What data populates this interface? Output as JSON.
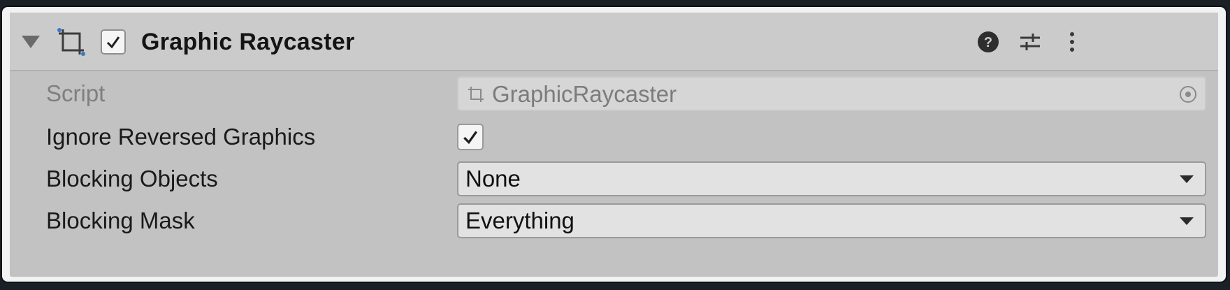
{
  "component": {
    "title": "Graphic Raycaster",
    "enabled": true,
    "header_icons": [
      "help-icon",
      "presets-icon",
      "more-options-icon"
    ]
  },
  "properties": {
    "script": {
      "label": "Script",
      "value": "GraphicRaycaster"
    },
    "ignore_reversed_graphics": {
      "label": "Ignore Reversed Graphics",
      "checked": true
    },
    "blocking_objects": {
      "label": "Blocking Objects",
      "value": "None"
    },
    "blocking_mask": {
      "label": "Blocking Mask",
      "value": "Everything"
    }
  }
}
